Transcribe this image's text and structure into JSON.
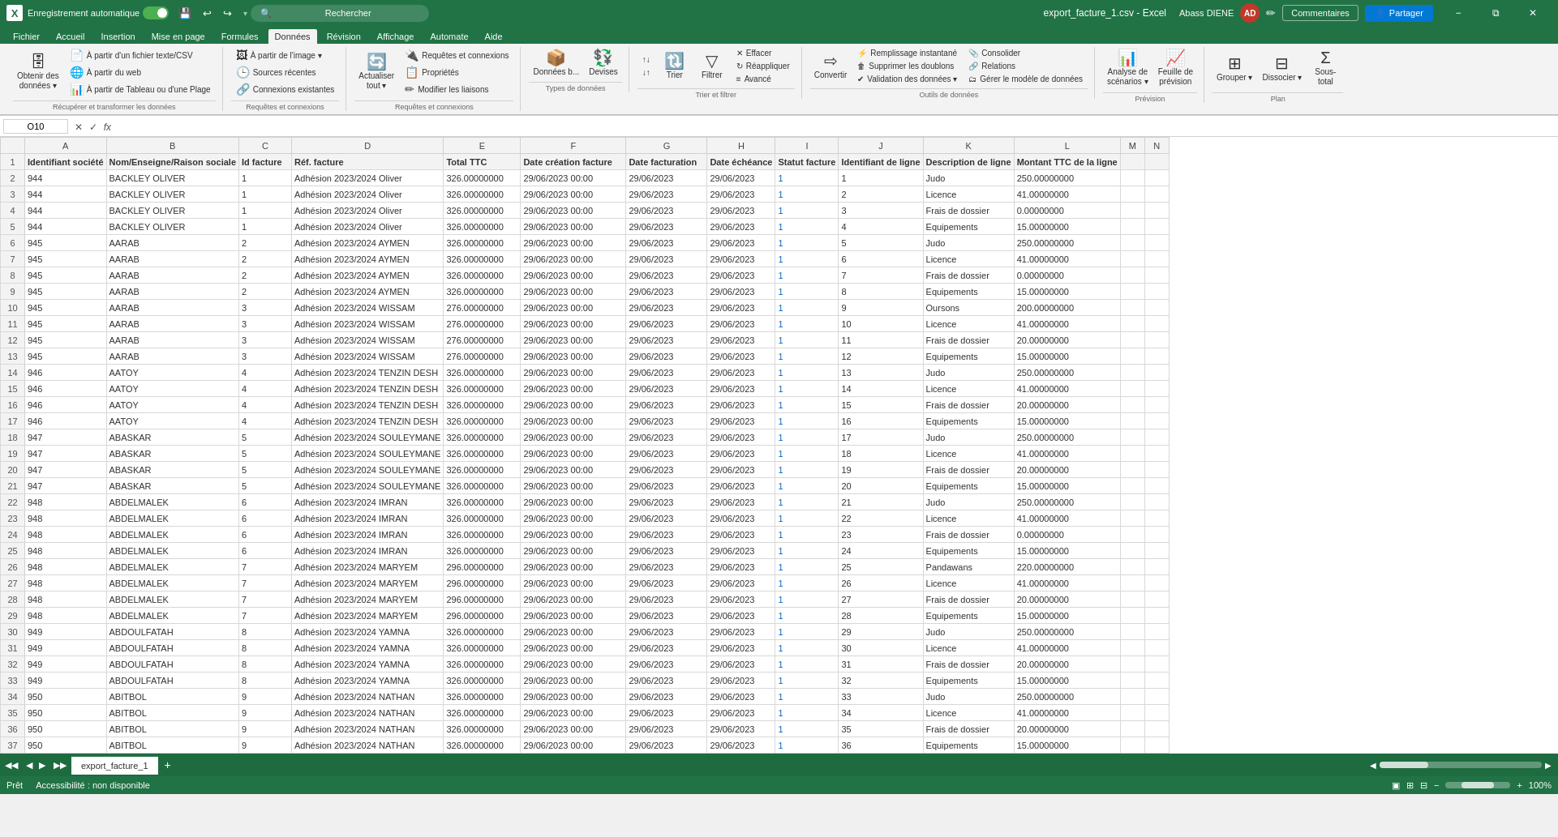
{
  "titleBar": {
    "appIcon": "X",
    "autoSave": "Enregistrement automatique",
    "saveIcon": "💾",
    "undoIcon": "↩",
    "redoIcon": "↪",
    "fileName": "export_facture_1.csv - Excel",
    "searchPlaceholder": "Rechercher",
    "userName": "Abass DIENE",
    "userInitials": "AD",
    "editIcon": "✏",
    "minimizeLabel": "−",
    "restoreLabel": "⧉",
    "closeLabel": "✕"
  },
  "menuBar": {
    "items": [
      "Fichier",
      "Accueil",
      "Insertion",
      "Mise en page",
      "Formules",
      "Données",
      "Révision",
      "Affichage",
      "Automate",
      "Aide"
    ],
    "active": "Données"
  },
  "ribbon": {
    "groups": [
      {
        "name": "Récupérer et transformer les données",
        "buttons": [
          {
            "id": "get-data",
            "icon": "🗄",
            "label": "Obtenir des\ndonnées ▾"
          },
          {
            "id": "from-text",
            "icon": "📄",
            "label": "À partir d'un fichier texte/CSV"
          },
          {
            "id": "from-web",
            "icon": "🌐",
            "label": "À partir du web"
          },
          {
            "id": "from-tableau",
            "icon": "📊",
            "label": "À partir de Tableau ou d'une Plage"
          }
        ]
      },
      {
        "name": "Requêtes et connexions",
        "buttons": [
          {
            "id": "from-image",
            "icon": "🖼",
            "label": "À partir de l'image ▾"
          },
          {
            "id": "recent-sources",
            "icon": "🕒",
            "label": "Sources récentes"
          },
          {
            "id": "existing-connections",
            "icon": "🔗",
            "label": "Connexions existantes"
          }
        ]
      },
      {
        "name": "Requêtes et connexions",
        "buttons": [
          {
            "id": "refresh-all",
            "icon": "🔄",
            "label": "Actualiser\ntout ▾"
          },
          {
            "id": "connections",
            "icon": "🔌",
            "label": "Requêtes et connexions"
          },
          {
            "id": "properties",
            "icon": "📋",
            "label": "Propriétés"
          },
          {
            "id": "edit-links",
            "icon": "✏",
            "label": "Modifier les liaisons"
          }
        ]
      },
      {
        "name": "Types de données",
        "buttons": [
          {
            "id": "data-types",
            "icon": "📦",
            "label": "Données b..."
          },
          {
            "id": "currencies",
            "icon": "💱",
            "label": "Devises"
          }
        ]
      },
      {
        "name": "Trier et filtrer",
        "buttons": [
          {
            "id": "sort-asc",
            "icon": "↑",
            "label": ""
          },
          {
            "id": "sort-desc",
            "icon": "↓",
            "label": ""
          },
          {
            "id": "sort",
            "icon": "🔃",
            "label": "Trier"
          },
          {
            "id": "filter",
            "icon": "▽",
            "label": "Filtrer"
          },
          {
            "id": "clear",
            "icon": "✕",
            "label": "Effacer"
          },
          {
            "id": "reapply",
            "icon": "↻",
            "label": "Réappliquer"
          },
          {
            "id": "advanced",
            "icon": "≡",
            "label": "Avancé"
          }
        ]
      },
      {
        "name": "Outils de données",
        "buttons": [
          {
            "id": "convert",
            "icon": "⇨",
            "label": "Convertir"
          },
          {
            "id": "flash-fill",
            "icon": "⚡",
            "label": "Remplissage instantané"
          },
          {
            "id": "remove-dups",
            "icon": "🗑",
            "label": "Supprimer les doublons"
          },
          {
            "id": "validate",
            "icon": "✔",
            "label": "Validation des données ▾"
          },
          {
            "id": "relations",
            "icon": "🔗",
            "label": "Relations"
          },
          {
            "id": "consolidate",
            "icon": "📎",
            "label": "Consolider"
          },
          {
            "id": "data-model",
            "icon": "🗂",
            "label": "Gérer le modèle de données"
          }
        ]
      },
      {
        "name": "Prévision",
        "buttons": [
          {
            "id": "scenarios",
            "icon": "📊",
            "label": "Analyse de\nscénarios ▾"
          },
          {
            "id": "forecast",
            "icon": "📈",
            "label": "Feuille de\nprévision"
          }
        ]
      },
      {
        "name": "Plan",
        "buttons": [
          {
            "id": "group",
            "icon": "⊞",
            "label": "Grouper ▾"
          },
          {
            "id": "ungroup",
            "icon": "⊟",
            "label": "Dissocier ▾"
          },
          {
            "id": "subtotal",
            "icon": "Σ",
            "label": "Sous-\ntotal"
          }
        ]
      }
    ]
  },
  "formulaBar": {
    "nameBox": "O10",
    "formula": ""
  },
  "columns": [
    {
      "id": "A",
      "label": "A",
      "width": 80
    },
    {
      "id": "B",
      "label": "B",
      "width": 145
    },
    {
      "id": "C",
      "label": "C",
      "width": 65
    },
    {
      "id": "D",
      "label": "D",
      "width": 185
    },
    {
      "id": "E",
      "label": "E",
      "width": 95
    },
    {
      "id": "F",
      "label": "F",
      "width": 130
    },
    {
      "id": "G",
      "label": "G",
      "width": 100
    },
    {
      "id": "H",
      "label": "H",
      "width": 80
    },
    {
      "id": "I",
      "label": "I",
      "width": 75
    },
    {
      "id": "J",
      "label": "J",
      "width": 95
    },
    {
      "id": "K",
      "label": "K",
      "width": 105
    },
    {
      "id": "L",
      "label": "L",
      "width": 95
    },
    {
      "id": "M",
      "label": "M",
      "width": 30
    },
    {
      "id": "N",
      "label": "N",
      "width": 30
    }
  ],
  "headers": {
    "row": [
      "Identifiant société",
      "Nom/Enseigne/Raison sociale",
      "Id facture",
      "Réf. facture",
      "Total TTC",
      "Date création facture",
      "Date facturation",
      "Date échéance",
      "Statut facture",
      "Identifiant de ligne",
      "Description de ligne",
      "Montant TTC de la ligne",
      "",
      ""
    ]
  },
  "rows": [
    [
      "944",
      "BACKLEY OLIVER",
      "1",
      "Adhésion 2023/2024 Oliver",
      "326.00000000",
      "29/06/2023 00:00",
      "29/06/2023",
      "29/06/2023",
      "1",
      "1",
      "Judo",
      "250.00000000",
      "",
      ""
    ],
    [
      "944",
      "BACKLEY OLIVER",
      "1",
      "Adhésion 2023/2024 Oliver",
      "326.00000000",
      "29/06/2023 00:00",
      "29/06/2023",
      "29/06/2023",
      "1",
      "2",
      "Licence",
      "41.00000000",
      "",
      ""
    ],
    [
      "944",
      "BACKLEY OLIVER",
      "1",
      "Adhésion 2023/2024 Oliver",
      "326.00000000",
      "29/06/2023 00:00",
      "29/06/2023",
      "29/06/2023",
      "1",
      "3",
      "Frais de dossier",
      "0.00000000",
      "",
      ""
    ],
    [
      "944",
      "BACKLEY OLIVER",
      "1",
      "Adhésion 2023/2024 Oliver",
      "326.00000000",
      "29/06/2023 00:00",
      "29/06/2023",
      "29/06/2023",
      "1",
      "4",
      "Equipements",
      "15.00000000",
      "",
      ""
    ],
    [
      "945",
      "AARAB",
      "2",
      "Adhésion 2023/2024 AYMEN",
      "326.00000000",
      "29/06/2023 00:00",
      "29/06/2023",
      "29/06/2023",
      "1",
      "5",
      "Judo",
      "250.00000000",
      "",
      ""
    ],
    [
      "945",
      "AARAB",
      "2",
      "Adhésion 2023/2024 AYMEN",
      "326.00000000",
      "29/06/2023 00:00",
      "29/06/2023",
      "29/06/2023",
      "1",
      "6",
      "Licence",
      "41.00000000",
      "",
      ""
    ],
    [
      "945",
      "AARAB",
      "2",
      "Adhésion 2023/2024 AYMEN",
      "326.00000000",
      "29/06/2023 00:00",
      "29/06/2023",
      "29/06/2023",
      "1",
      "7",
      "Frais de dossier",
      "0.00000000",
      "",
      ""
    ],
    [
      "945",
      "AARAB",
      "2",
      "Adhésion 2023/2024 AYMEN",
      "326.00000000",
      "29/06/2023 00:00",
      "29/06/2023",
      "29/06/2023",
      "1",
      "8",
      "Equipements",
      "15.00000000",
      "",
      ""
    ],
    [
      "945",
      "AARAB",
      "3",
      "Adhésion 2023/2024 WISSAM",
      "276.00000000",
      "29/06/2023 00:00",
      "29/06/2023",
      "29/06/2023",
      "1",
      "9",
      "Oursons",
      "200.00000000",
      "",
      ""
    ],
    [
      "945",
      "AARAB",
      "3",
      "Adhésion 2023/2024 WISSAM",
      "276.00000000",
      "29/06/2023 00:00",
      "29/06/2023",
      "29/06/2023",
      "1",
      "10",
      "Licence",
      "41.00000000",
      "",
      ""
    ],
    [
      "945",
      "AARAB",
      "3",
      "Adhésion 2023/2024 WISSAM",
      "276.00000000",
      "29/06/2023 00:00",
      "29/06/2023",
      "29/06/2023",
      "1",
      "11",
      "Frais de dossier",
      "20.00000000",
      "",
      ""
    ],
    [
      "945",
      "AARAB",
      "3",
      "Adhésion 2023/2024 WISSAM",
      "276.00000000",
      "29/06/2023 00:00",
      "29/06/2023",
      "29/06/2023",
      "1",
      "12",
      "Equipements",
      "15.00000000",
      "",
      ""
    ],
    [
      "946",
      "AATOY",
      "4",
      "Adhésion 2023/2024 TENZIN DESH",
      "326.00000000",
      "29/06/2023 00:00",
      "29/06/2023",
      "29/06/2023",
      "1",
      "13",
      "Judo",
      "250.00000000",
      "",
      ""
    ],
    [
      "946",
      "AATOY",
      "4",
      "Adhésion 2023/2024 TENZIN DESH",
      "326.00000000",
      "29/06/2023 00:00",
      "29/06/2023",
      "29/06/2023",
      "1",
      "14",
      "Licence",
      "41.00000000",
      "",
      ""
    ],
    [
      "946",
      "AATOY",
      "4",
      "Adhésion 2023/2024 TENZIN DESH",
      "326.00000000",
      "29/06/2023 00:00",
      "29/06/2023",
      "29/06/2023",
      "1",
      "15",
      "Frais de dossier",
      "20.00000000",
      "",
      ""
    ],
    [
      "946",
      "AATOY",
      "4",
      "Adhésion 2023/2024 TENZIN DESH",
      "326.00000000",
      "29/06/2023 00:00",
      "29/06/2023",
      "29/06/2023",
      "1",
      "16",
      "Equipements",
      "15.00000000",
      "",
      ""
    ],
    [
      "947",
      "ABASKAR",
      "5",
      "Adhésion 2023/2024 SOULEYMANE",
      "326.00000000",
      "29/06/2023 00:00",
      "29/06/2023",
      "29/06/2023",
      "1",
      "17",
      "Judo",
      "250.00000000",
      "",
      ""
    ],
    [
      "947",
      "ABASKAR",
      "5",
      "Adhésion 2023/2024 SOULEYMANE",
      "326.00000000",
      "29/06/2023 00:00",
      "29/06/2023",
      "29/06/2023",
      "1",
      "18",
      "Licence",
      "41.00000000",
      "",
      ""
    ],
    [
      "947",
      "ABASKAR",
      "5",
      "Adhésion 2023/2024 SOULEYMANE",
      "326.00000000",
      "29/06/2023 00:00",
      "29/06/2023",
      "29/06/2023",
      "1",
      "19",
      "Frais de dossier",
      "20.00000000",
      "",
      ""
    ],
    [
      "947",
      "ABASKAR",
      "5",
      "Adhésion 2023/2024 SOULEYMANE",
      "326.00000000",
      "29/06/2023 00:00",
      "29/06/2023",
      "29/06/2023",
      "1",
      "20",
      "Equipements",
      "15.00000000",
      "",
      ""
    ],
    [
      "948",
      "ABDELMALEK",
      "6",
      "Adhésion 2023/2024 IMRAN",
      "326.00000000",
      "29/06/2023 00:00",
      "29/06/2023",
      "29/06/2023",
      "1",
      "21",
      "Judo",
      "250.00000000",
      "",
      ""
    ],
    [
      "948",
      "ABDELMALEK",
      "6",
      "Adhésion 2023/2024 IMRAN",
      "326.00000000",
      "29/06/2023 00:00",
      "29/06/2023",
      "29/06/2023",
      "1",
      "22",
      "Licence",
      "41.00000000",
      "",
      ""
    ],
    [
      "948",
      "ABDELMALEK",
      "6",
      "Adhésion 2023/2024 IMRAN",
      "326.00000000",
      "29/06/2023 00:00",
      "29/06/2023",
      "29/06/2023",
      "1",
      "23",
      "Frais de dossier",
      "0.00000000",
      "",
      ""
    ],
    [
      "948",
      "ABDELMALEK",
      "6",
      "Adhésion 2023/2024 IMRAN",
      "326.00000000",
      "29/06/2023 00:00",
      "29/06/2023",
      "29/06/2023",
      "1",
      "24",
      "Equipements",
      "15.00000000",
      "",
      ""
    ],
    [
      "948",
      "ABDELMALEK",
      "7",
      "Adhésion 2023/2024 MARYEM",
      "296.00000000",
      "29/06/2023 00:00",
      "29/06/2023",
      "29/06/2023",
      "1",
      "25",
      "Pandawans",
      "220.00000000",
      "",
      ""
    ],
    [
      "948",
      "ABDELMALEK",
      "7",
      "Adhésion 2023/2024 MARYEM",
      "296.00000000",
      "29/06/2023 00:00",
      "29/06/2023",
      "29/06/2023",
      "1",
      "26",
      "Licence",
      "41.00000000",
      "",
      ""
    ],
    [
      "948",
      "ABDELMALEK",
      "7",
      "Adhésion 2023/2024 MARYEM",
      "296.00000000",
      "29/06/2023 00:00",
      "29/06/2023",
      "29/06/2023",
      "1",
      "27",
      "Frais de dossier",
      "20.00000000",
      "",
      ""
    ],
    [
      "948",
      "ABDELMALEK",
      "7",
      "Adhésion 2023/2024 MARYEM",
      "296.00000000",
      "29/06/2023 00:00",
      "29/06/2023",
      "29/06/2023",
      "1",
      "28",
      "Equipements",
      "15.00000000",
      "",
      ""
    ],
    [
      "949",
      "ABDOULFATAH",
      "8",
      "Adhésion 2023/2024 YAMNA",
      "326.00000000",
      "29/06/2023 00:00",
      "29/06/2023",
      "29/06/2023",
      "1",
      "29",
      "Judo",
      "250.00000000",
      "",
      ""
    ],
    [
      "949",
      "ABDOULFATAH",
      "8",
      "Adhésion 2023/2024 YAMNA",
      "326.00000000",
      "29/06/2023 00:00",
      "29/06/2023",
      "29/06/2023",
      "1",
      "30",
      "Licence",
      "41.00000000",
      "",
      ""
    ],
    [
      "949",
      "ABDOULFATAH",
      "8",
      "Adhésion 2023/2024 YAMNA",
      "326.00000000",
      "29/06/2023 00:00",
      "29/06/2023",
      "29/06/2023",
      "1",
      "31",
      "Frais de dossier",
      "20.00000000",
      "",
      ""
    ],
    [
      "949",
      "ABDOULFATAH",
      "8",
      "Adhésion 2023/2024 YAMNA",
      "326.00000000",
      "29/06/2023 00:00",
      "29/06/2023",
      "29/06/2023",
      "1",
      "32",
      "Equipements",
      "15.00000000",
      "",
      ""
    ],
    [
      "950",
      "ABITBOL",
      "9",
      "Adhésion 2023/2024 NATHAN",
      "326.00000000",
      "29/06/2023 00:00",
      "29/06/2023",
      "29/06/2023",
      "1",
      "33",
      "Judo",
      "250.00000000",
      "",
      ""
    ],
    [
      "950",
      "ABITBOL",
      "9",
      "Adhésion 2023/2024 NATHAN",
      "326.00000000",
      "29/06/2023 00:00",
      "29/06/2023",
      "29/06/2023",
      "1",
      "34",
      "Licence",
      "41.00000000",
      "",
      ""
    ],
    [
      "950",
      "ABITBOL",
      "9",
      "Adhésion 2023/2024 NATHAN",
      "326.00000000",
      "29/06/2023 00:00",
      "29/06/2023",
      "29/06/2023",
      "1",
      "35",
      "Frais de dossier",
      "20.00000000",
      "",
      ""
    ],
    [
      "950",
      "ABITBOL",
      "9",
      "Adhésion 2023/2024 NATHAN",
      "326.00000000",
      "29/06/2023 00:00",
      "29/06/2023",
      "29/06/2023",
      "1",
      "36",
      "Equipements",
      "15.00000000",
      "",
      ""
    ]
  ],
  "sheetTabs": {
    "tabs": [
      "export_facture_1"
    ],
    "active": "export_facture_1"
  },
  "statusBar": {
    "mode": "Prêt",
    "accessibility": "Accessibilité : non disponible"
  }
}
